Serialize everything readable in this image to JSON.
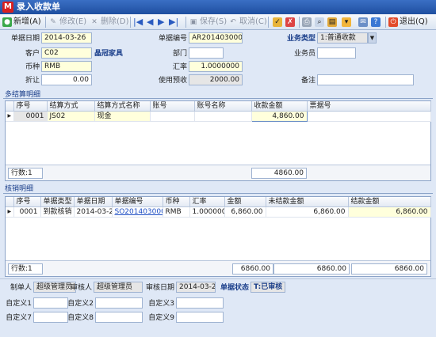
{
  "window": {
    "title": "录入收款单",
    "logo": "M"
  },
  "toolbar": {
    "new": "新增(A)",
    "edit": "修改(E)",
    "delete": "删除(D)",
    "save": "保存(S)",
    "cancel": "取消(C)",
    "exit": "退出(Q)"
  },
  "header": {
    "bill_date_label": "单据日期",
    "bill_date": "2014-03-26",
    "bill_no_label": "单据编号",
    "bill_no": "AR2014030003",
    "biz_type_label": "业务类型",
    "biz_type": "1:普通收款",
    "customer_label": "客户",
    "customer_code": "C02",
    "customer_name": "晶冠家具",
    "dept_label": "部门",
    "dept": "",
    "salesman_label": "业务员",
    "salesman": "",
    "currency_label": "币种",
    "currency": "RMB",
    "rate_label": "汇率",
    "rate": "1.0000000",
    "discount_label": "折让",
    "discount": "0.00",
    "prepay_label": "使用预收",
    "prepay": "2000.00",
    "remark_label": "备注",
    "remark": ""
  },
  "settle": {
    "section_title": "多结算明细",
    "columns": [
      "序号",
      "结算方式",
      "结算方式名称",
      "账号",
      "账号名称",
      "收款金额",
      "票据号"
    ],
    "rows": [
      {
        "no": "0001",
        "method": "JS02",
        "method_name": "现金",
        "account": "",
        "account_name": "",
        "amount": "4,860.00",
        "ticket": ""
      }
    ],
    "row_count": "行数:1",
    "total": "4860.00"
  },
  "verify": {
    "section_title": "核销明细",
    "columns": [
      "序号",
      "单据类型",
      "单据日期",
      "单据编号",
      "币种",
      "汇率",
      "金额",
      "未结款金额",
      "结款金额"
    ],
    "rows": [
      {
        "no": "0001",
        "type": "到款核销",
        "date": "2014-03-26",
        "bill_no": "SO2014030004",
        "currency": "RMB",
        "rate": "1.0000000",
        "amount": "6,860.00",
        "unsettled": "6,860.00",
        "settled": "6,860.00"
      }
    ],
    "row_count": "行数:1",
    "total_amount": "6860.00",
    "total_unsettled": "6860.00",
    "total_settled": "6860.00"
  },
  "footer": {
    "maker_label": "制单人",
    "maker": "超级管理员",
    "auditor_label": "审核人",
    "auditor": "超级管理员",
    "audit_date_label": "审核日期",
    "audit_date": "2014-03-26",
    "status_label": "单据状态",
    "status": "T:已审核",
    "custom": [
      "自定义1",
      "自定义2",
      "自定义3",
      "自定义7",
      "自定义8",
      "自定义9"
    ]
  }
}
